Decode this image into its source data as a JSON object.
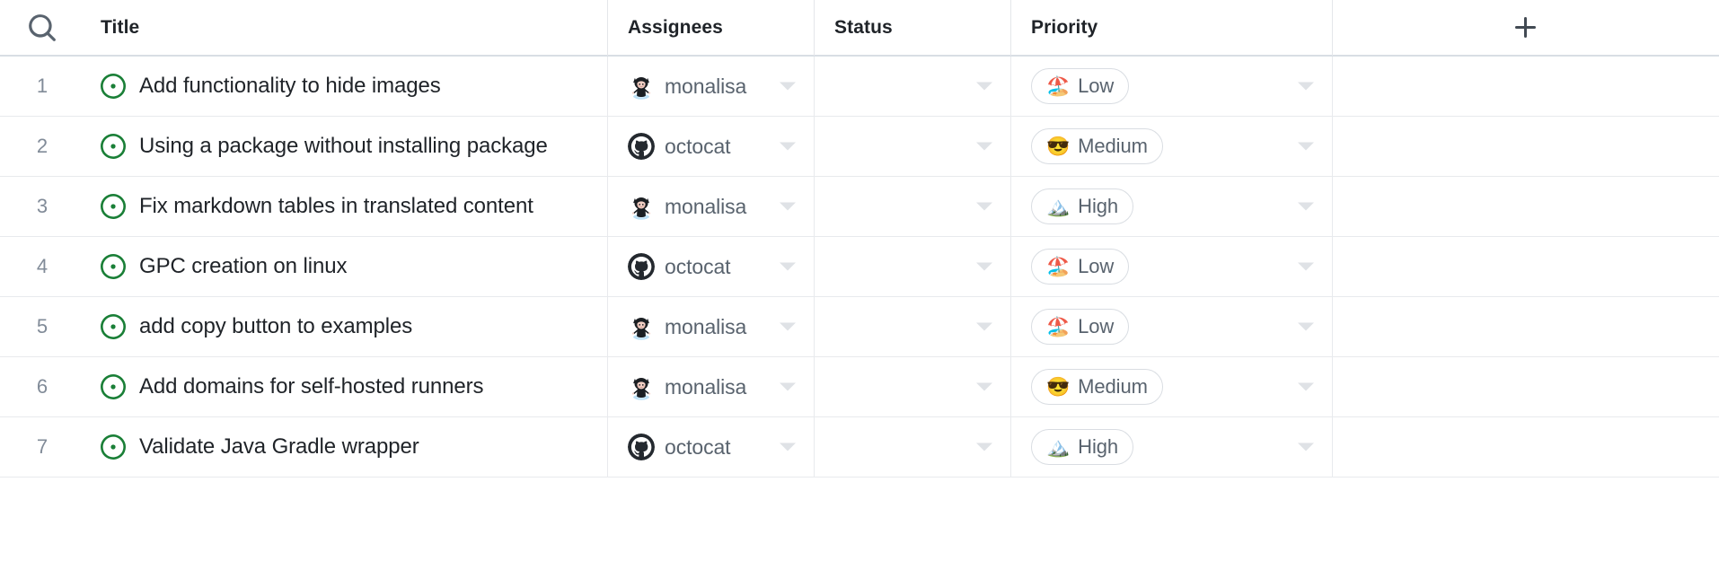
{
  "header": {
    "search_icon": "search-icon",
    "add_column_icon": "plus-icon",
    "columns": [
      {
        "key": "title",
        "label": "Title"
      },
      {
        "key": "assignees",
        "label": "Assignees"
      },
      {
        "key": "status",
        "label": "Status"
      },
      {
        "key": "priority",
        "label": "Priority"
      }
    ]
  },
  "priority_options": {
    "low": {
      "label": "Low",
      "emoji": "🏖️"
    },
    "medium": {
      "label": "Medium",
      "emoji": "😎"
    },
    "high": {
      "label": "High",
      "emoji": "🏔️"
    }
  },
  "assignee_options": {
    "monalisa": {
      "name": "monalisa",
      "avatar": "monalisa-avatar"
    },
    "octocat": {
      "name": "octocat",
      "avatar": "octocat-avatar"
    }
  },
  "colors": {
    "issue_open_green": "#1a7f37",
    "row_number_gray": "#818b98",
    "title_text": "#1f2328",
    "secondary_text": "#59636e",
    "border": "#e8eaed",
    "header_border": "#d8dee4",
    "caret": "#dfe2e6"
  },
  "rows": [
    {
      "number": "1",
      "status_icon": "issue-open-icon",
      "title": "Add functionality to hide images",
      "assignee": "monalisa",
      "status": "",
      "priority": "low"
    },
    {
      "number": "2",
      "status_icon": "issue-open-icon",
      "title": "Using a package without installing package",
      "assignee": "octocat",
      "status": "",
      "priority": "medium"
    },
    {
      "number": "3",
      "status_icon": "issue-open-icon",
      "title": "Fix markdown tables in translated content",
      "assignee": "monalisa",
      "status": "",
      "priority": "high"
    },
    {
      "number": "4",
      "status_icon": "issue-open-icon",
      "title": "GPC creation on linux",
      "assignee": "octocat",
      "status": "",
      "priority": "low"
    },
    {
      "number": "5",
      "status_icon": "issue-open-icon",
      "title": "add copy button to examples",
      "assignee": "monalisa",
      "status": "",
      "priority": "low"
    },
    {
      "number": "6",
      "status_icon": "issue-open-icon",
      "title": "Add domains for self-hosted runners",
      "assignee": "monalisa",
      "status": "",
      "priority": "medium"
    },
    {
      "number": "7",
      "status_icon": "issue-open-icon",
      "title": "Validate Java Gradle wrapper",
      "assignee": "octocat",
      "status": "",
      "priority": "high"
    }
  ]
}
